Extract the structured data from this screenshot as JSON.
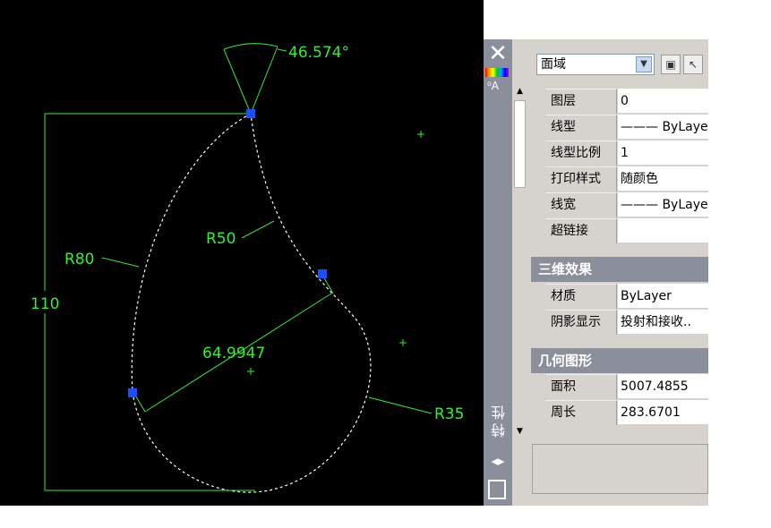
{
  "drawing": {
    "angle_dim": "46.574°",
    "r50": "R50",
    "r80": "R80",
    "r35": "R35",
    "height_dim": "110",
    "aligned_dim": "64.9947"
  },
  "palette": {
    "title": "特性",
    "object_type": "面域",
    "general": [
      {
        "label": "图层",
        "value": "0"
      },
      {
        "label": "线型",
        "value": "——— ByLayer"
      },
      {
        "label": "线型比例",
        "value": "1"
      },
      {
        "label": "打印样式",
        "value": "随颜色"
      },
      {
        "label": "线宽",
        "value": "——— ByLayer"
      },
      {
        "label": "超链接",
        "value": ""
      }
    ],
    "section_3d": "三维效果",
    "effects_3d": [
      {
        "label": "材质",
        "value": "ByLayer"
      },
      {
        "label": "阴影显示",
        "value": "投射和接收.."
      }
    ],
    "section_geometry": "几何图形",
    "geometry": [
      {
        "label": "面积",
        "value": "5007.4855"
      },
      {
        "label": "周长",
        "value": "283.6701"
      }
    ]
  },
  "colors": {
    "canvas": "#000000",
    "cad_green": "#33ee33",
    "grip": "#1a4fff",
    "palette_bg": "#d6d3ce",
    "title_strip": "#8b8f9b"
  },
  "icons": [
    "close-icon",
    "quick-select-icon",
    "select-objects-icon",
    "scroll-up-icon",
    "scroll-down-icon",
    "auto-hide-icon",
    "properties-icon"
  ]
}
